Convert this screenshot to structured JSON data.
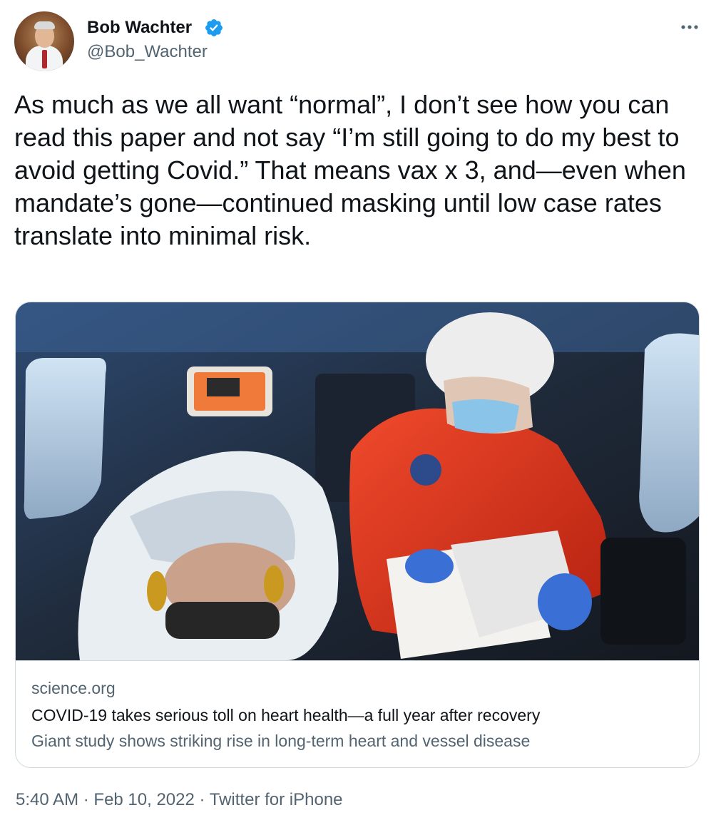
{
  "author": {
    "name": "Bob Wachter",
    "handle": "@Bob_Wachter",
    "verified_icon": "verified-badge-icon",
    "avatar_icon": "profile-photo"
  },
  "more_icon": "more-options-icon",
  "tweet_text": "As much as we all want “normal”, I don’t see how you can read this paper and not say “I’m still going to do my best to avoid getting Covid.” That means vax x 3, and—even when mandate’s gone—continued masking until low case rates translate into minimal risk.",
  "card": {
    "image": "photo of medic in red suit and helmet writing on clipboard beside patient in helicopter",
    "domain": "science.org",
    "title": "COVID-19 takes serious toll on heart health—a full year after recovery",
    "description": "Giant study shows striking rise in long-term heart and vessel disease"
  },
  "footer": {
    "time": "5:40 AM",
    "separator": "·",
    "date": "Feb 10, 2022",
    "source": "Twitter for iPhone"
  },
  "colors": {
    "text": "#0f1419",
    "secondary": "#536471",
    "border": "#cfd9de",
    "verified": "#1d9bf0"
  }
}
